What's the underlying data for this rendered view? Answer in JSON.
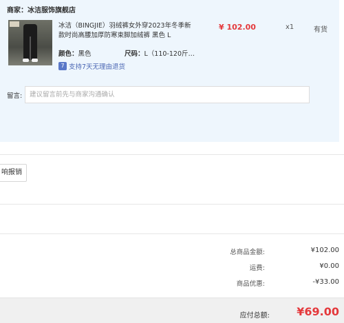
{
  "merchant": {
    "label": "商家：",
    "name": "冰洁服饰旗舰店"
  },
  "product": {
    "title": "冰洁（BINGJIE）羽绒裤女外穿2023年冬季新款时尚高腰加厚防寒束脚加绒裤 黑色 L",
    "color_label": "颜色：",
    "color_value": "黑色",
    "size_label": "尺码：",
    "size_value": "L（110-120斤…",
    "return_icon": "7",
    "return_text": "支持7天无理由退货",
    "price": "¥ 102.00",
    "quantity": "x1",
    "stock": "有货"
  },
  "message": {
    "label": "留言:",
    "placeholder": "建议留言前先与商家沟通确认"
  },
  "invoice": {
    "button_label": "响报销"
  },
  "summary": {
    "goods_total_label": "总商品金额:",
    "goods_total_value": "¥102.00",
    "shipping_label": "运费:",
    "shipping_value": "¥0.00",
    "discount_label": "商品优惠:",
    "discount_value": "-¥33.00"
  },
  "total": {
    "label": "应付总额:",
    "value": "¥69.00"
  },
  "colors": {
    "accent_red": "#e4393c",
    "panel_bg": "#eef6fd",
    "badge_blue": "#5a78c8"
  }
}
